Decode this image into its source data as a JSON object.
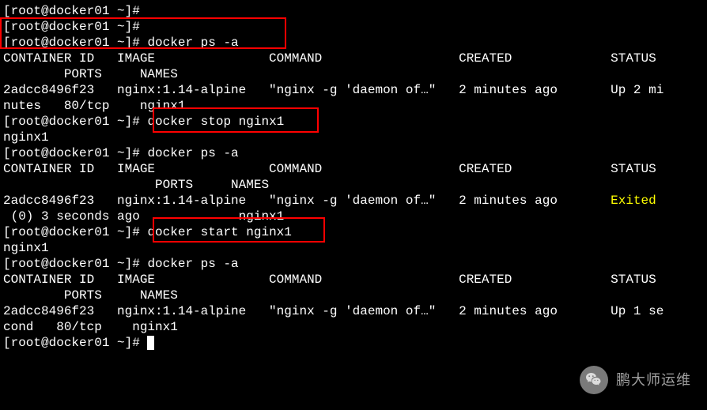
{
  "prompt": "[root@docker01 ~]# ",
  "cmd_ps": "docker ps -a",
  "cmd_stop": "docker stop nginx1",
  "cmd_start": "docker start nginx1",
  "container_name": "nginx1",
  "header_line1": "CONTAINER ID   IMAGE               COMMAND                  CREATED             STATUS",
  "header_line2": "        PORTS     NAMES",
  "header_alt_line2": "                    PORTS     NAMES",
  "row1_line1_a": "2adcc8496f23   nginx:1.14-alpine   \"nginx -g 'daemon of…\"   2 minutes ago       ",
  "row1_line1_b": "Up 2 mi",
  "row1_line2": "nutes   80/tcp    nginx1",
  "row2_line1_a": "2adcc8496f23   nginx:1.14-alpine   \"nginx -g 'daemon of…\"   2 minutes ago       ",
  "row2_line1_b": "Exited",
  "row2_line2": " (0) 3 seconds ago             nginx1",
  "row3_line1_a": "2adcc8496f23   nginx:1.14-alpine   \"nginx -g 'daemon of…\"   2 minutes ago       ",
  "row3_line1_b": "Up 1 se",
  "row3_line2": "cond   80/tcp    nginx1",
  "watermark_text": "鹏大师运维"
}
